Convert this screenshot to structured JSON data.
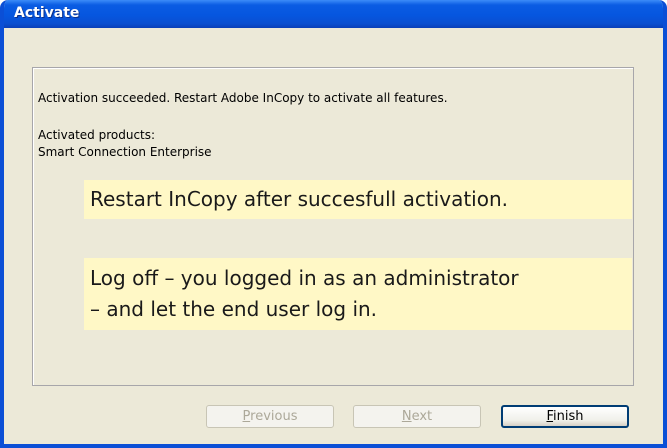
{
  "window": {
    "title": "Activate"
  },
  "content": {
    "status_message": "Activation succeeded. Restart Adobe InCopy to activate all features.",
    "products_heading": "Activated products:",
    "products": [
      "Smart Connection Enterprise"
    ]
  },
  "callouts": [
    {
      "lines": [
        "Restart InCopy after succesfull activation."
      ]
    },
    {
      "lines": [
        "Log off – you logged in as an administrator",
        "– and let the end user log in."
      ]
    }
  ],
  "buttons": {
    "previous": {
      "mnemonic": "P",
      "rest": "revious",
      "enabled": false
    },
    "next": {
      "mnemonic": "N",
      "rest": "ext",
      "enabled": false
    },
    "finish": {
      "mnemonic": "F",
      "rest": "inish",
      "enabled": true
    }
  },
  "colors": {
    "titlebar": "#0656df",
    "dialog_background": "#ece9d8",
    "callout_background": "#fff8c6",
    "default_button_border": "#003c74"
  }
}
